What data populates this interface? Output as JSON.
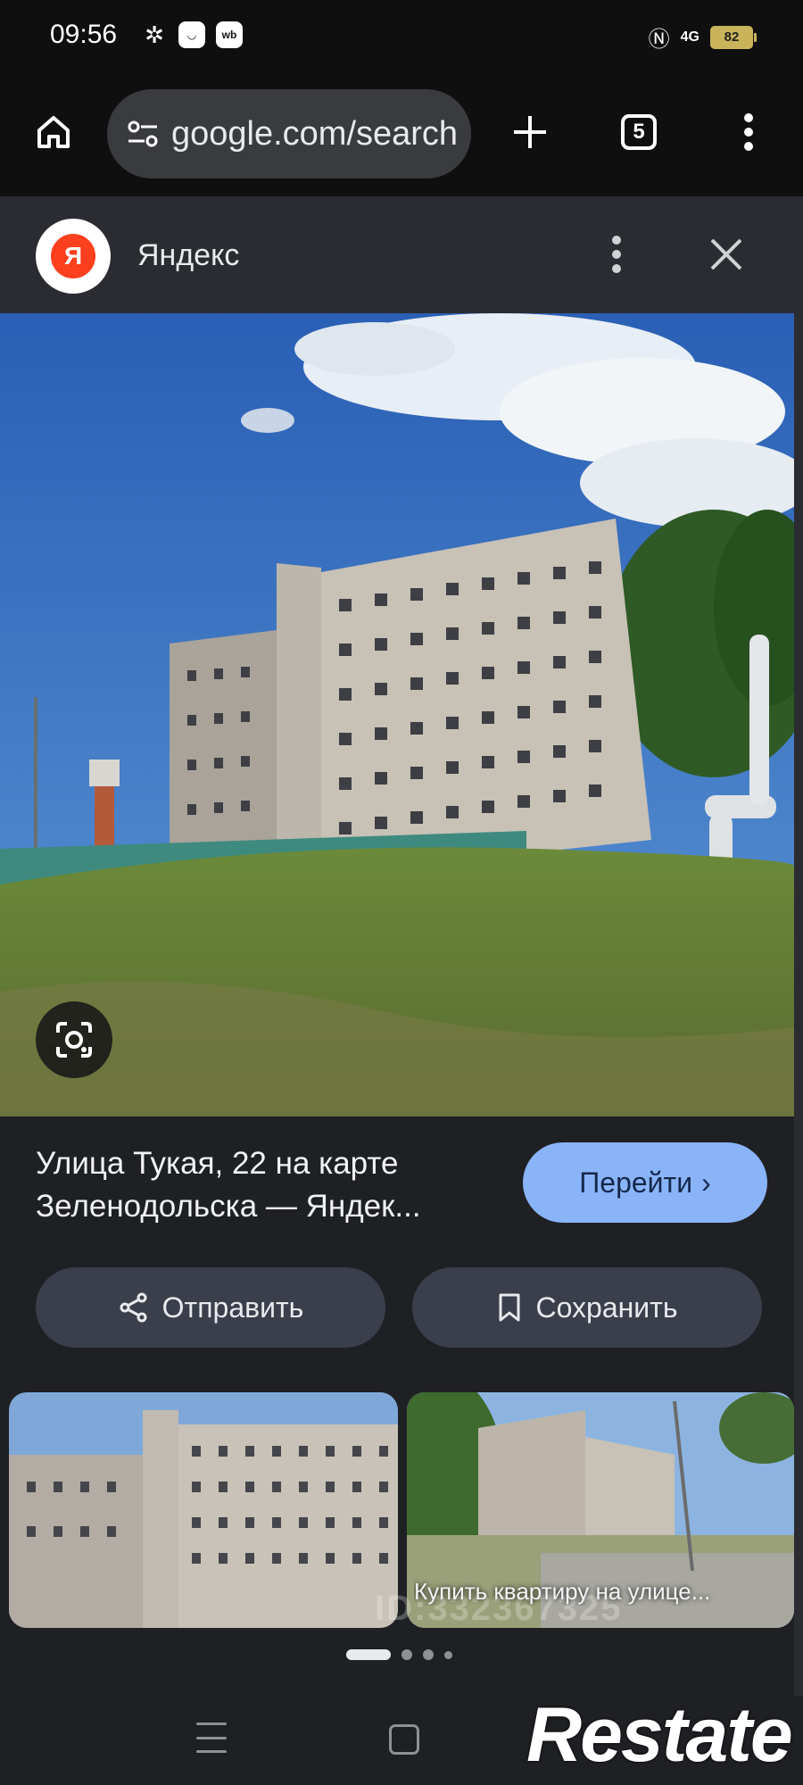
{
  "status_bar": {
    "time": "09:56",
    "battery": "82",
    "network": "4G"
  },
  "browser": {
    "url": "google.com/search",
    "tab_count": "5"
  },
  "panel": {
    "source_name": "Яндекс",
    "source_logo_letter": "Я"
  },
  "result": {
    "title": "Улица Тукая, 22 на карте Зеленодольска — Яндек...",
    "goto_label": "Перейти",
    "send_label": "Отправить",
    "save_label": "Сохранить"
  },
  "related": [
    {
      "caption": ""
    },
    {
      "caption": "Купить квартиру на улице..."
    }
  ],
  "watermark": {
    "id_text": "ID:332367325",
    "logo_text": "Restate"
  },
  "carousel": {
    "pages": 4,
    "active_page": 1
  },
  "colors": {
    "accent": "#8ab4f8",
    "yandex_red": "#fc3f1d",
    "panel_bg": "#2b2c31"
  }
}
